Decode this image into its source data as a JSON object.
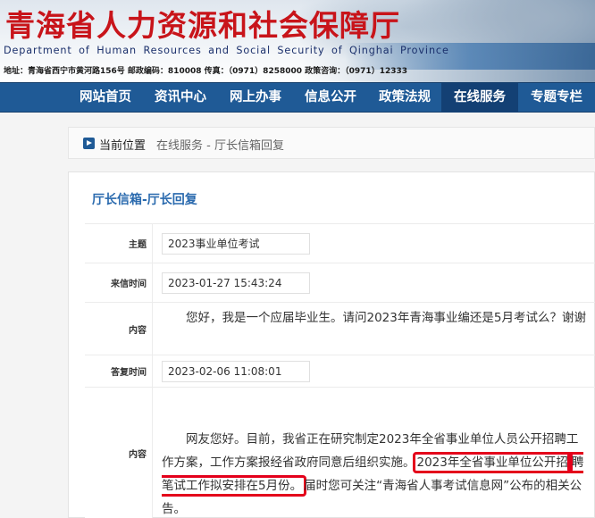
{
  "header": {
    "title": "青海省人力资源和社会保障厅",
    "subtitle": "Department of Human Resources and Social Security of Qinghai Province",
    "address": "地址：青海省西宁市黄河路156号    邮政编码：810008    传真：（0971）8258000    政策咨询：（0971）12333"
  },
  "nav": {
    "items": [
      "网站首页",
      "资讯中心",
      "网上办事",
      "信息公开",
      "政策法规",
      "在线服务",
      "专题专栏"
    ],
    "active": "在线服务"
  },
  "breadcrumb": {
    "label": "当前位置",
    "path": "在线服务 - 厅长信箱回复"
  },
  "panel": {
    "title": "厅长信箱-厅长回复",
    "rows": {
      "subject": {
        "label": "主题",
        "value": "2023事业单位考试"
      },
      "sent_time": {
        "label": "来信时间",
        "value": "2023-01-27 15:43:24"
      },
      "content": {
        "label": "内容",
        "value": "您好，我是一个应届毕业生。请问2023年青海事业编还是5月考试么？谢谢"
      },
      "reply_time": {
        "label": "答复时间",
        "value": "2023-02-06 11:08:01"
      },
      "reply": {
        "label": "内容",
        "part1": "网友您好。目前，我省正在研究制定2023年全省事业单位人员公开招聘工作方案，工作方案报经省政府同意后组织实施。",
        "highlight_a": "2023年全省事业单位公开招",
        "highlight_b": "聘笔试工作拟安排在5月份。",
        "part2": "届时您可关注“青海省人事考试信息网”公布的相关公告。"
      }
    }
  },
  "colors": {
    "title_red": "#c8141a",
    "nav_blue": "#1f5a96",
    "nav_active": "#134074",
    "panel_title_blue": "#2a6aae",
    "highlight_border": "#e4001b"
  }
}
